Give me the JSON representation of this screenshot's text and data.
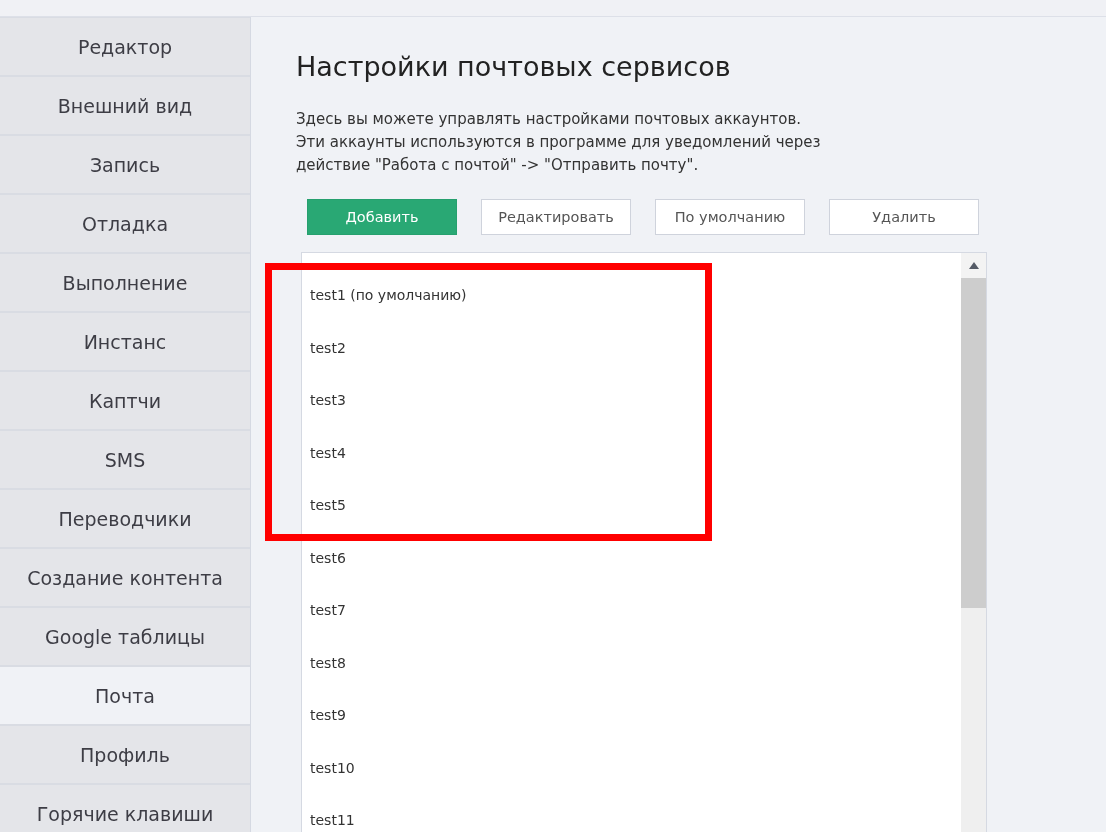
{
  "sidebar": {
    "items": [
      {
        "label": "Редактор",
        "selected": false
      },
      {
        "label": "Внешний вид",
        "selected": false
      },
      {
        "label": "Запись",
        "selected": false
      },
      {
        "label": "Отладка",
        "selected": false
      },
      {
        "label": "Выполнение",
        "selected": false
      },
      {
        "label": "Инстанс",
        "selected": false
      },
      {
        "label": "Каптчи",
        "selected": false
      },
      {
        "label": "SMS",
        "selected": false
      },
      {
        "label": "Переводчики",
        "selected": false
      },
      {
        "label": "Создание контента",
        "selected": false
      },
      {
        "label": "Google таблицы",
        "selected": false
      },
      {
        "label": "Почта",
        "selected": true
      },
      {
        "label": "Профиль",
        "selected": false
      },
      {
        "label": "Горячие клавиши",
        "selected": false
      }
    ]
  },
  "title": "Настройки почтовых сервисов",
  "description": "Здесь вы можете управлять настройками почтовых аккаунтов.\nЭти аккаунты используются в программе для уведомлений через\nдействие \"Работа с почтой\" -> \"Отправить почту\".",
  "buttons": [
    {
      "label": "Добавить",
      "kind": "primary"
    },
    {
      "label": "Редактировать",
      "kind": "secondary"
    },
    {
      "label": "По умолчанию",
      "kind": "secondary"
    },
    {
      "label": "Удалить",
      "kind": "secondary"
    }
  ],
  "accounts": [
    {
      "label": "test1 (по умолчанию)"
    },
    {
      "label": "test2"
    },
    {
      "label": "test3"
    },
    {
      "label": "test4"
    },
    {
      "label": "test5"
    },
    {
      "label": "test6"
    },
    {
      "label": "test7"
    },
    {
      "label": "test8"
    },
    {
      "label": "test9"
    },
    {
      "label": "test10"
    },
    {
      "label": "test11"
    }
  ]
}
